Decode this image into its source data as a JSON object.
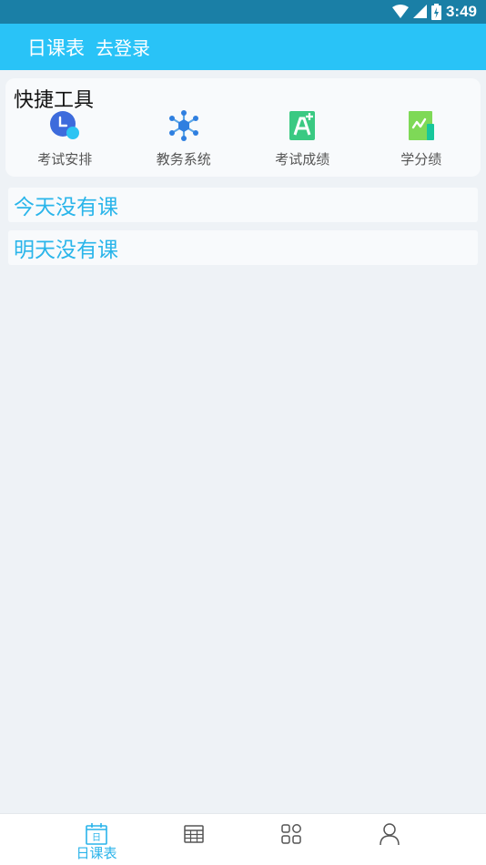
{
  "status_bar": {
    "time": "3:49"
  },
  "app_bar": {
    "title": "日课表",
    "login_label": "去登录"
  },
  "quick_tools": {
    "title": "快捷工具",
    "items": [
      {
        "label": "考试安排",
        "icon": "clock-icon"
      },
      {
        "label": "教务系统",
        "icon": "network-icon"
      },
      {
        "label": "考试成绩",
        "icon": "grade-a-plus-icon"
      },
      {
        "label": "学分绩",
        "icon": "chart-document-icon"
      }
    ]
  },
  "schedule": {
    "today": "今天没有课",
    "tomorrow": "明天没有课"
  },
  "bottom_nav": {
    "items": [
      {
        "label": "日课表",
        "icon": "calendar-day-icon",
        "active": true
      },
      {
        "label": "",
        "icon": "table-grid-icon",
        "active": false
      },
      {
        "label": "",
        "icon": "apps-icon",
        "active": false
      },
      {
        "label": "",
        "icon": "user-icon",
        "active": false
      }
    ]
  },
  "colors": {
    "status_bar": "#1a7fa6",
    "app_bar": "#29c3f7",
    "accent": "#2ab5ea",
    "background": "#eef2f6"
  }
}
